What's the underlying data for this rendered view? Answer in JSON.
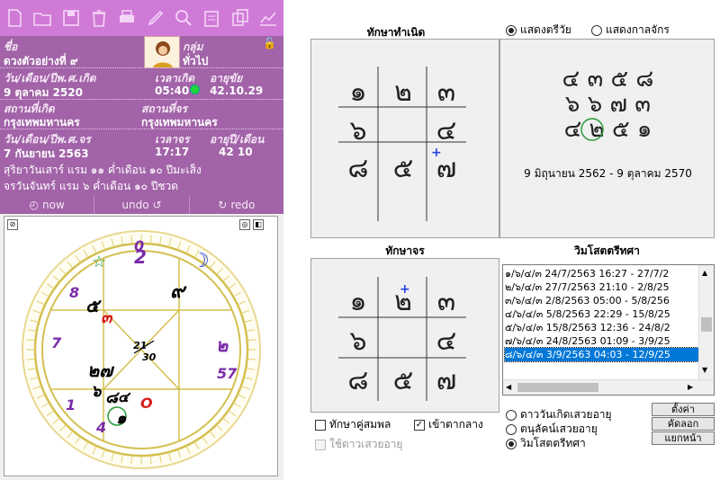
{
  "toolbar": {
    "icons": [
      "new-file-icon",
      "open-folder-icon",
      "save-icon",
      "delete-icon",
      "print-icon",
      "edit-icon",
      "search-icon",
      "clipboard-icon",
      "copy-icon",
      "graph-icon"
    ]
  },
  "info": {
    "name_label": "ชื่อ",
    "group_label": "กลุ่ม",
    "name_value": "ดวงตัวอย่างที่ ๙",
    "group_value": "ทั่วไป",
    "birth_date_label": "วัน/เดือน/ปีพ.ศ.เกิด",
    "birth_time_label": "เวลาเกิด",
    "age_label": "อายุขัย",
    "birth_date": "9 ตุลาคม 2520",
    "birth_time": "05:40",
    "age_value": "42.10.29",
    "birthplace_label": "สถานที่เกิด",
    "currentplace_label": "สถานที่จร",
    "birthplace": "กรุงเทพมหานคร",
    "currentplace": "กรุงเทพมหานคร",
    "transit_date_label": "วัน/เดือน/ปีพ.ศ.จร",
    "transit_time_label": "เวลาจร",
    "transit_age_label": "อายุปี/เดือน",
    "transit_date": "7 กันยายน 2563",
    "transit_time": "17:17",
    "transit_age": "42 10",
    "line1": "สุริยาวันเสาร์ แรม ๑๑ ค่ำเดือน ๑๐ ปีมะเส็ง",
    "line2": "จรวันจันทร์ แรม ๖ ค่ำเดือน ๑๐ ปีชวด"
  },
  "actions": {
    "now": "now",
    "undo": "undo",
    "redo": "redo"
  },
  "chart": {
    "labels": [
      {
        "t": "0",
        "c": "#7a2ca8"
      },
      {
        "t": "2",
        "c": "#7a2ca8"
      },
      {
        "t": "☆",
        "c": "#1a9a3a"
      },
      {
        "t": "☽",
        "c": "#2244dd"
      },
      {
        "t": "8",
        "c": "#7a2ca8"
      },
      {
        "t": "๙",
        "c": "#000"
      },
      {
        "t": "๕",
        "c": "#000"
      },
      {
        "t": "๓",
        "c": "#d81b1b"
      },
      {
        "t": "7",
        "c": "#7a2ca8"
      },
      {
        "t": "21",
        "c": "#000"
      },
      {
        "t": "30",
        "c": "#000"
      },
      {
        "t": "๒",
        "c": "#7a2ca8"
      },
      {
        "t": "57",
        "c": "#7a2ca8"
      },
      {
        "t": "๒๗",
        "c": "#000"
      },
      {
        "t": "๖",
        "c": "#000"
      },
      {
        "t": "๘",
        "c": "#000"
      },
      {
        "t": "๔",
        "c": "#000"
      },
      {
        "t": "O",
        "c": "#d81b1b"
      },
      {
        "t": "1",
        "c": "#7a2ca8"
      },
      {
        "t": "๑",
        "c": "#000"
      },
      {
        "t": "4",
        "c": "#7a2ca8"
      }
    ]
  },
  "right": {
    "natal_title": "ทักษาทำเนิด",
    "opt_show_tri": "แสดงตรีวัย",
    "opt_show_kal": "แสดงกาลจักร",
    "natal_grid": [
      "๑",
      "๒",
      "๓",
      "๖",
      "",
      "๔",
      "๘",
      "๕",
      "๗"
    ],
    "natal_mark": "+",
    "tri_rows": [
      "๔ ๓ ๕ ๘",
      "๖ ๖ ๗ ๓",
      "๔ ๒ ๕ ๑"
    ],
    "tri_range": "9 มิถุนายน 2562 - 9 ตุลาคม 2570",
    "transit_title": "ทักษาจร",
    "vim_title": "วิมโสตตรีทศา",
    "transit_grid": [
      "๑",
      "๒",
      "๓",
      "๖",
      "",
      "๔",
      "๘",
      "๕",
      "๗"
    ],
    "transit_mark": "+",
    "list": [
      "๑/๖/๔/๓ 24/7/2563 16:27 - 27/7/2",
      "๒/๖/๔/๓ 27/7/2563 21:10 - 2/8/25",
      "๓/๖/๔/๓ 2/8/2563 05:00 - 5/8/256",
      "๔/๖/๔/๓ 5/8/2563 22:29 - 15/8/25",
      "๕/๖/๔/๓ 15/8/2563 12:36 - 24/8/2",
      "๗/๖/๔/๓ 24/8/2563 01:09 - 3/9/25",
      "๘/๖/๔/๓ 3/9/2563 04:03 - 12/9/25"
    ],
    "list_selected": 6,
    "cb_spouse": "ทักษาคู่สมพล",
    "cb_center": "เข้าตากลาง",
    "cb_use": "ใช้ดาวเสวยอายุ",
    "r_natal_age": "ดาววันเกิดเสวยอายุ",
    "r_transit_age": "ตนุลัคน์เสวยอายุ",
    "r_vim": "วิมโสตตรีทศา",
    "btn_set": "ตั้งค่า",
    "btn_copy": "คัดลอก",
    "btn_detach": "แยกหน้า"
  }
}
